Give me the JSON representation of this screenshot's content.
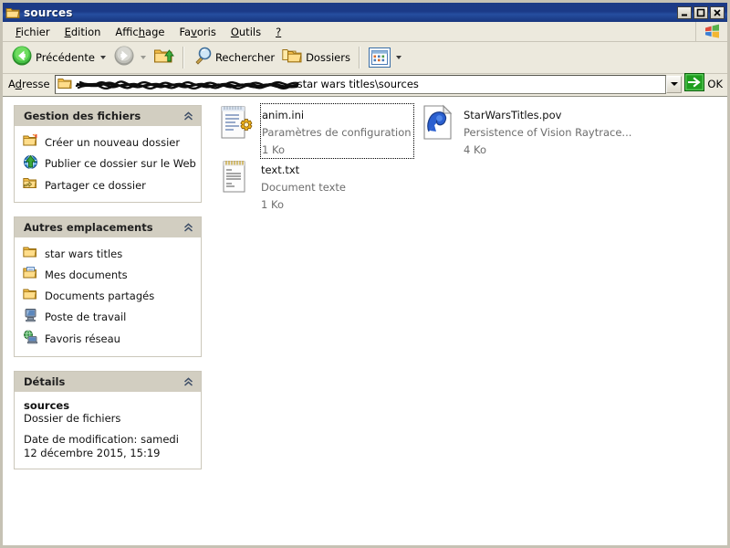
{
  "window": {
    "title": "sources",
    "icon": "folder-icon",
    "buttons": {
      "minimize": "minimize-button",
      "maximize": "maximize-button",
      "close": "close-button"
    }
  },
  "menubar": {
    "items": [
      {
        "label": "Fichier",
        "accel_index": 0
      },
      {
        "label": "Edition",
        "accel_index": 0
      },
      {
        "label": "Affichage",
        "accel_index": 5
      },
      {
        "label": "Favoris",
        "accel_index": 2
      },
      {
        "label": "Outils",
        "accel_index": 0
      },
      {
        "label": "?",
        "accel_index": 0
      }
    ],
    "flag_icon": "windows-flag-icon"
  },
  "toolbar": {
    "back_label": "Précédente",
    "back_icon": "back-arrow-icon",
    "forward_icon": "forward-arrow-icon",
    "up_icon": "up-folder-icon",
    "search_label": "Rechercher",
    "search_icon": "magnifier-icon",
    "folders_label": "Dossiers",
    "folders_icon": "folders-icon",
    "views_icon": "views-grid-icon"
  },
  "addressbar": {
    "label": "Adresse",
    "folder_icon": "folder-icon",
    "redacted": true,
    "value_visible": "star wars titles\\sources",
    "dropdown_icon": "chevron-down-icon",
    "go_label": "OK",
    "go_icon": "go-arrow-icon"
  },
  "sidebar": {
    "panels": [
      {
        "title": "Gestion des fichiers",
        "collapse_icon": "chevrons-up-icon",
        "rows": [
          {
            "label": "Créer un nouveau dossier",
            "icon": "new-folder-icon"
          },
          {
            "label": "Publier ce dossier sur le Web",
            "icon": "publish-web-icon"
          },
          {
            "label": "Partager ce dossier",
            "icon": "share-folder-icon"
          }
        ]
      },
      {
        "title": "Autres emplacements",
        "collapse_icon": "chevrons-up-icon",
        "rows": [
          {
            "label": "star wars titles",
            "icon": "folder-icon"
          },
          {
            "label": "Mes documents",
            "icon": "my-documents-icon"
          },
          {
            "label": "Documents partagés",
            "icon": "folder-icon"
          },
          {
            "label": "Poste de travail",
            "icon": "my-computer-icon"
          },
          {
            "label": "Favoris réseau",
            "icon": "network-icon"
          }
        ]
      },
      {
        "title": "Détails",
        "collapse_icon": "chevrons-up-icon",
        "details": {
          "name": "sources",
          "type": "Dossier de fichiers",
          "date": "Date de modification: samedi 12 décembre 2015, 15:19"
        }
      }
    ]
  },
  "files": [
    {
      "name": "anim.ini",
      "type": "Paramètres de configuration",
      "size": "1 Ko",
      "icon": "ini-config-file-icon",
      "focused": true
    },
    {
      "name": "StarWarsTitles.pov",
      "type": "Persistence of Vision Raytrace...",
      "size": "4 Ko",
      "icon": "pov-ray-file-icon",
      "focused": false
    },
    {
      "name": "text.txt",
      "type": "Document texte",
      "size": "1 Ko",
      "icon": "text-file-icon",
      "focused": false
    }
  ],
  "colors": {
    "titlebar_start": "#1d3b86",
    "titlebar_end": "#17357e",
    "chrome": "#ece9dd",
    "panel_header": "#d2cec1",
    "window_border": "#c6c2b4",
    "content_bg": "#ffffff",
    "subtext": "#6d6d6d",
    "accent_green": "#1e9e1e"
  }
}
